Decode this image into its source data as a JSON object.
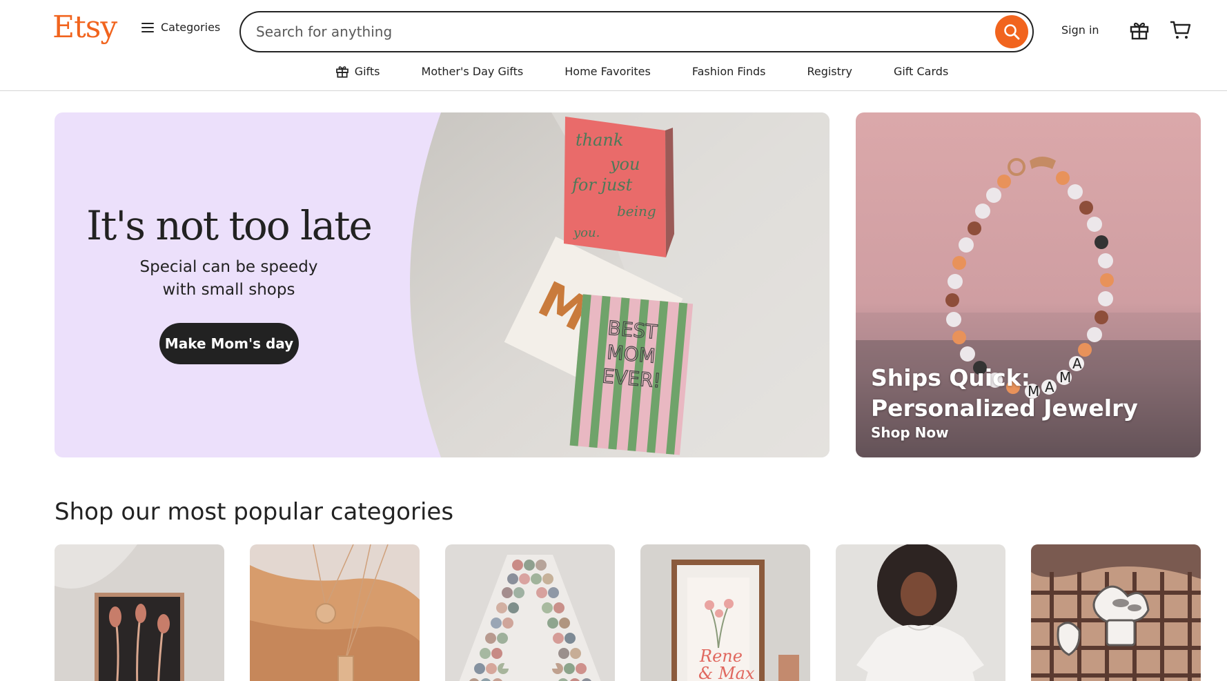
{
  "header": {
    "logo": "Etsy",
    "categories_label": "Categories",
    "search_placeholder": "Search for anything",
    "sign_in": "Sign in"
  },
  "subnav": {
    "items": [
      "Gifts",
      "Mother's Day Gifts",
      "Home Favorites",
      "Fashion Finds",
      "Registry",
      "Gift Cards"
    ]
  },
  "hero": {
    "title": "It's not too late",
    "subtitle_line1": "Special can be speedy",
    "subtitle_line2": "with small shops",
    "cta": "Make Mom's day",
    "card_top_text": [
      "thank",
      "you",
      "for just",
      "being",
      "you."
    ],
    "card_middle_text": "MOM",
    "card_bottom_text": [
      "BEST",
      "MOM",
      "EVER!"
    ]
  },
  "promo": {
    "title_line1": "Ships Quick:",
    "title_line2": "Personalized Jewelry",
    "link": "Shop Now",
    "bead_letters": [
      "M",
      "A",
      "M",
      "A"
    ]
  },
  "categories_section": {
    "title": "Shop our most popular categories",
    "print_text_line1": "Rene",
    "print_text_line2": "& Max"
  },
  "colors": {
    "brand": "#f1641e",
    "hero_bg": "#ece0fb",
    "text": "#222222",
    "promo_bg": "#d9a7a7"
  }
}
